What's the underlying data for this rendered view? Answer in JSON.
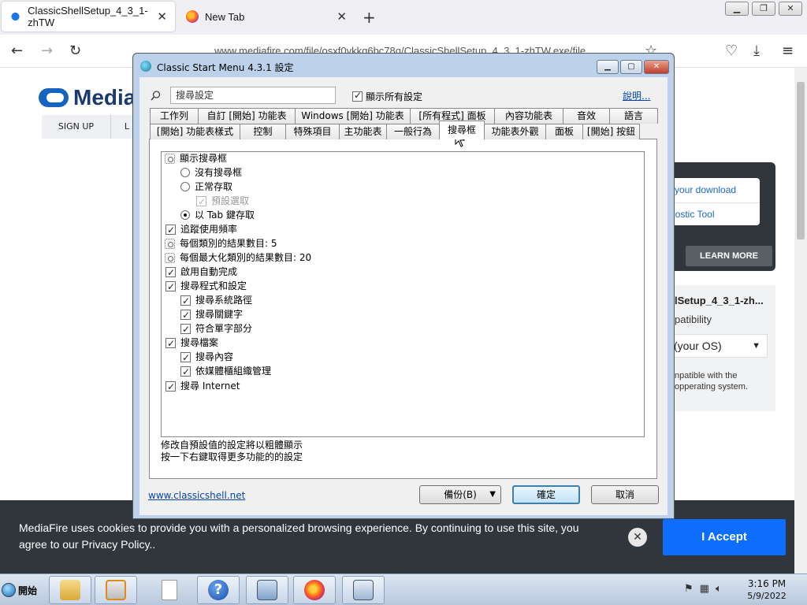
{
  "browser": {
    "tabs": [
      {
        "label": "ClassicShellSetup_4_3_1-zhTW",
        "icon": "mediafire-icon"
      },
      {
        "label": "New Tab",
        "icon": "firefox-icon"
      }
    ],
    "url": "www.mediafire.com/file/osxf0vkkq6bc78q/ClassicShellSetup_4_3_1-zhTW.exe/file"
  },
  "page": {
    "logo_text": "Media",
    "signup_label": "SIGN UP",
    "login_partial": "L",
    "download_link": "your download",
    "diag_link": "nostic Tool",
    "learn_more": "LEARN MORE",
    "file_name": "lSetup_4_3_1-zh...",
    "compat_label": "patibility",
    "os_select": "(your OS)",
    "compat_note": "npatible with the\nopperating system.",
    "cookie_text": "MediaFire uses cookies to provide you with a personalized browsing experience. By continuing to use this site, you agree to our Privacy Policy..",
    "accept_label": "I Accept"
  },
  "dialog": {
    "title": "Classic Start Menu 4.3.1 設定",
    "search_placeholder": "搜尋設定",
    "show_all_label": "顯示所有設定",
    "help_label": "說明...",
    "tabs_row1": [
      "工作列",
      "自訂 [開始] 功能表",
      "Windows [開始] 功能表",
      "[所有程式] 面板",
      "內容功能表",
      "音效",
      "語言"
    ],
    "tabs_row2": [
      "[開始] 功能表樣式",
      "控制",
      "特殊項目",
      "主功能表",
      "一般行為",
      "搜尋框",
      "功能表外觀",
      "面板",
      "[開始] 按鈕"
    ],
    "selected_tab": "搜尋框",
    "tree": {
      "show_search": "顯示搜尋框",
      "no_search": "沒有搜尋框",
      "normal_access": "正常存取",
      "default_select": "預設選取",
      "tab_access": "以 Tab 鍵存取",
      "track_usage": "追蹤使用頻率",
      "results_per_cat": "每個類別的結果數目: 5",
      "results_max_cat": "每個最大化類別的結果數目: 20",
      "autocomplete": "啟用自動完成",
      "search_programs": "搜尋程式和設定",
      "search_path": "搜尋系統路徑",
      "search_keywords": "搜尋關鍵字",
      "match_partial": "符合單字部分",
      "search_files": "搜尋檔案",
      "search_contents": "搜尋內容",
      "by_media": "依媒體櫃組織管理",
      "search_internet": "搜尋 Internet"
    },
    "hint_line1": "修改自預設值的設定將以粗體顯示",
    "hint_line2": "按一下右鍵取得更多功能的的設定",
    "site_link": "www.classicshell.net",
    "backup_label": "備份(B)",
    "ok_label": "確定",
    "cancel_label": "取消"
  },
  "taskbar": {
    "start_label": "開始",
    "time": "3:16 PM",
    "date": "5/9/2022"
  }
}
